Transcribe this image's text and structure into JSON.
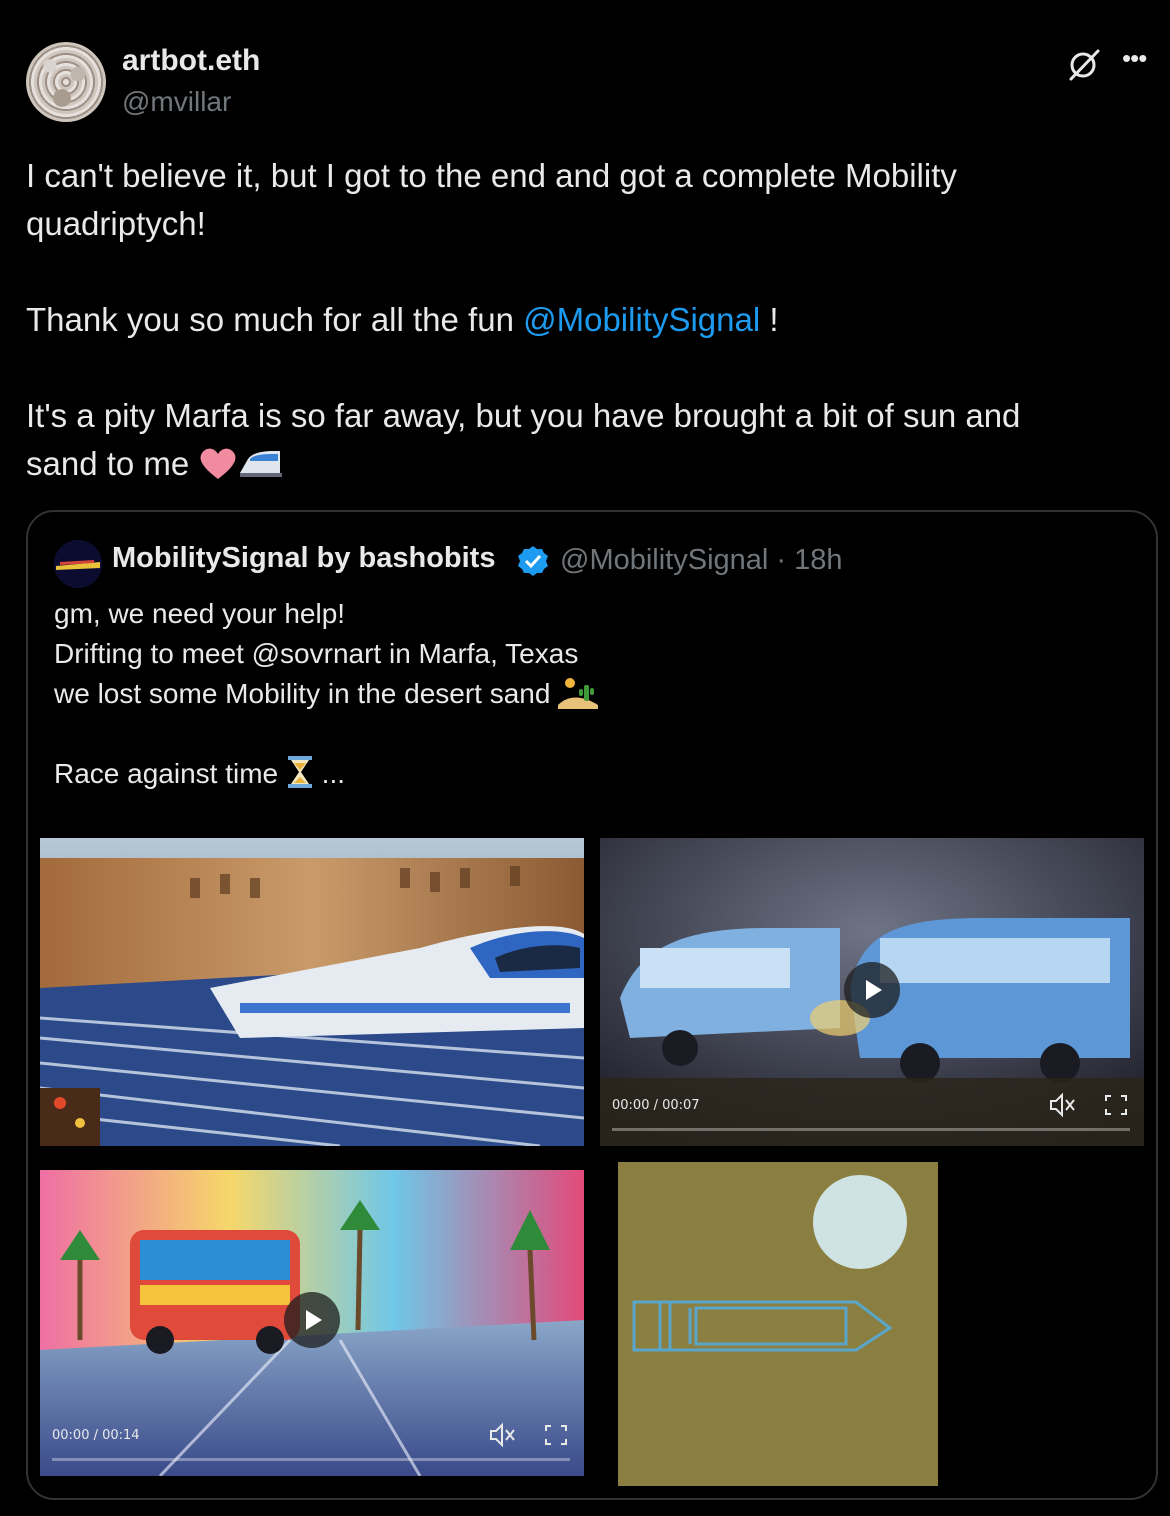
{
  "author": {
    "display_name": "artbot.eth",
    "handle": "@mvillar"
  },
  "tweet": {
    "line1": "I can't believe it, but I got to the end and got a complete  Mobility",
    "line2": "quadriptych!",
    "line3_prefix": "Thank you so much for all the fun ",
    "line3_mention": "@MobilitySignal",
    "line3_suffix": " !",
    "line4": "It's a pity Marfa is so far away, but you have brought a bit of sun and",
    "line5": "sand to me "
  },
  "quoted": {
    "display_name": "MobilitySignal by bashobits",
    "handle_time": "@MobilitySignal · 18h",
    "line1": "gm, we need your help!",
    "line2": "Drifting to meet @sovrnart in Marfa, Texas",
    "line3": "we lost some Mobility in the desert sand ",
    "line4": "Race against time ",
    "line4_suffix": " ...",
    "media": [
      {
        "kind": "image",
        "icon": "train-painting"
      },
      {
        "kind": "video",
        "time": "00:00 / 00:07"
      },
      {
        "kind": "video",
        "time": "00:00 / 00:14"
      },
      {
        "kind": "image",
        "icon": "moon-and-train-drawing"
      }
    ]
  },
  "colors": {
    "background": "#000000",
    "text": "#e7e9ea",
    "muted": "#71767b",
    "link": "#1d9bf0",
    "border": "#2f3336"
  }
}
